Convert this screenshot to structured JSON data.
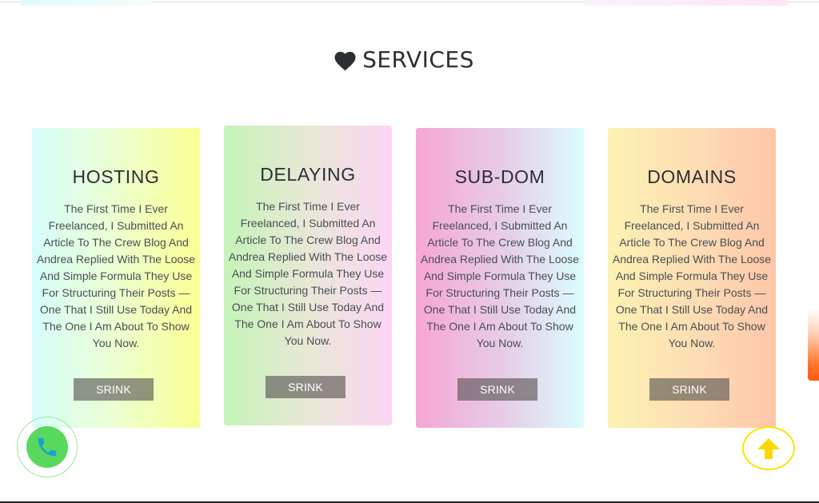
{
  "section": {
    "title": "SERVICES",
    "icon": "heart-icon"
  },
  "cards": [
    {
      "title": "HOSTING",
      "description": "The First Time I Ever Freelanced, I Submitted An Article To The Crew Blog And Andrea Replied With The Loose And Simple Formula They Use For Structuring Their Posts — One That I Still Use Today And The One I Am About To Show You Now.",
      "button_label": "SRINK"
    },
    {
      "title": "DELAYING",
      "description": "The First Time I Ever Freelanced, I Submitted An Article To The Crew Blog And Andrea Replied With The Loose And Simple Formula They Use For Structuring Their Posts — One That I Still Use Today And The One I Am About To Show You Now.",
      "button_label": "SRINK"
    },
    {
      "title": "SUB-DOM",
      "description": "The First Time I Ever Freelanced, I Submitted An Article To The Crew Blog And Andrea Replied With The Loose And Simple Formula They Use For Structuring Their Posts — One That I Still Use Today And The One I Am About To Show You Now.",
      "button_label": "SRINK"
    },
    {
      "title": "DOMAINS",
      "description": "The First Time I Ever Freelanced, I Submitted An Article To The Crew Blog And Andrea Replied With The Loose And Simple Formula They Use For Structuring Their Posts — One That I Still Use Today And The One I Am About To Show You Now.",
      "button_label": "SRINK"
    }
  ],
  "floating": {
    "phone_icon": "phone-icon",
    "scroll_top_icon": "arrow-up-icon"
  },
  "colors": {
    "phone_button": "#58d95e",
    "scroll_top_accent": "#fbe400",
    "button_bg": "#7a7672",
    "title_text": "#2b2f33"
  }
}
